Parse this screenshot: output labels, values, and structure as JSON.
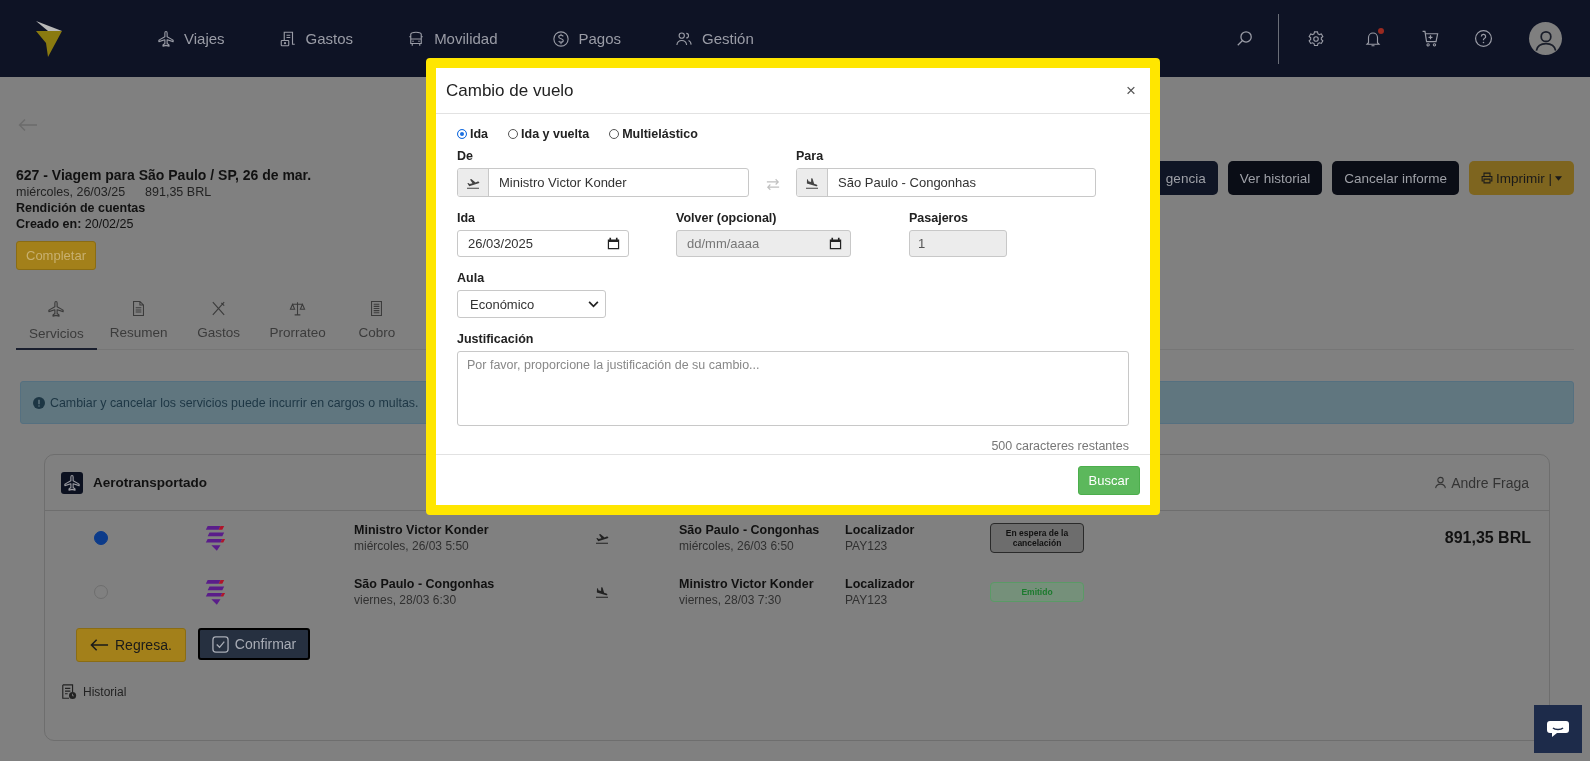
{
  "nav": {
    "items": [
      {
        "label": "Viajes"
      },
      {
        "label": "Gastos"
      },
      {
        "label": "Movilidad"
      },
      {
        "label": "Pagos"
      },
      {
        "label": "Gestión"
      }
    ],
    "notifications_unread": true
  },
  "report": {
    "title": "627 - Viagem para São Paulo / SP, 26 de mar.",
    "date": "miércoles, 26/03/25",
    "amount": "891,35 BRL",
    "type": "Rendición de cuentas",
    "created": "**Creado en:** 20/02/25",
    "complete_button": "Completar",
    "actions": [
      {
        "label": "gencia",
        "kind": "dark"
      },
      {
        "label": "Ver historial",
        "kind": "dark"
      },
      {
        "label": "Cancelar informe",
        "kind": "dark"
      },
      {
        "label": "Imprimir |",
        "kind": "print"
      }
    ]
  },
  "tabs": [
    {
      "label": "Servicios",
      "selected": true
    },
    {
      "label": "Resumen",
      "selected": false
    },
    {
      "label": "Gastos",
      "selected": false
    },
    {
      "label": "Prorrateo",
      "selected": false
    },
    {
      "label": "Cobro",
      "selected": false
    }
  ],
  "alert": "Cambiar y cancelar los servicios puede incurrir en cargos o multas.",
  "service": {
    "title": "Aerotransportado",
    "traveler": "Andre Fraga",
    "rows": [
      {
        "selected": true,
        "kind": "outbound",
        "origin": "Ministro Victor Konder",
        "origin_time": "miércoles, 26/03 5:50",
        "destination": "São Paulo - Congonhas",
        "destination_time": "miércoles, 26/03 6:50",
        "locator_label": "Localizador",
        "locator": "PAY123",
        "status": {
          "label": "En espera de la cancelación",
          "kind": "pending"
        },
        "price": "891,35 BRL"
      },
      {
        "selected": false,
        "kind": "return",
        "origin": "São Paulo - Congonhas",
        "origin_time": "viernes, 28/03 6:30",
        "destination": "Ministro Victor Konder",
        "destination_time": "viernes, 28/03 7:30",
        "locator_label": "Localizador",
        "locator": "PAY123",
        "status": {
          "label": "Emitido",
          "kind": "issued"
        }
      }
    ],
    "back_button": "Regresa.",
    "confirm_button": "Confirmar",
    "history_link": "Historial"
  },
  "modal": {
    "title": "Cambio de vuelo",
    "close": "×",
    "trip_types": [
      {
        "label": "Ida",
        "selected": true
      },
      {
        "label": "Ida y vuelta",
        "selected": false
      },
      {
        "label": "Multielástico",
        "selected": false
      }
    ],
    "from": {
      "label": "De",
      "value": "Ministro Victor Konder"
    },
    "to": {
      "label": "Para",
      "value": "São Paulo - Congonhas"
    },
    "departure": {
      "label": "Ida",
      "value": "26/03/2025",
      "disabled": false
    },
    "return": {
      "label": "Volver (opcional)",
      "placeholder": "dd/mm/aaaa",
      "disabled": true
    },
    "passengers": {
      "label": "Pasajeros",
      "value": "1",
      "disabled": true
    },
    "cabin": {
      "label": "Aula",
      "value": "Económico"
    },
    "justification": {
      "label": "Justificación",
      "placeholder": "Por favor, proporcione la justificación de su cambio..."
    },
    "counter": "500 caracteres restantes",
    "search_button": "Buscar"
  }
}
